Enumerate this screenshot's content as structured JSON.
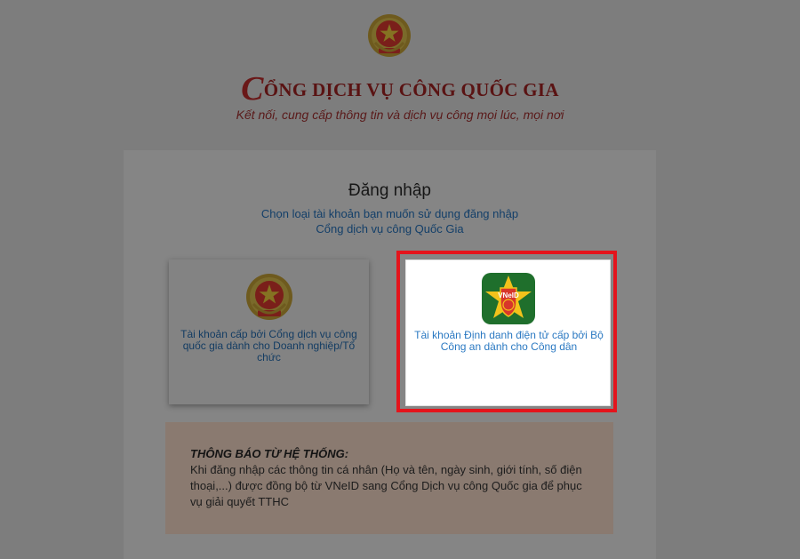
{
  "header": {
    "title_first_letter": "C",
    "title_rest": "ỔNG DỊCH VỤ CÔNG QUỐC GIA",
    "subtitle": "Kết nối, cung cấp thông tin và dịch vụ công mọi lúc, mọi nơi"
  },
  "login": {
    "title": "Đăng nhập",
    "hint_line1": "Chọn loại tài khoản bạn muốn sử dụng đăng nhập",
    "hint_line2": "Cổng dịch vụ công Quốc Gia"
  },
  "cards": {
    "organization": {
      "label": "Tài khoản cấp bởi Cổng dịch vụ công quốc gia dành cho Doanh nghiệp/Tổ chức",
      "icon": "national-emblem-icon"
    },
    "citizen": {
      "label": "Tài khoản Định danh điện tử cấp bởi Bộ Công an dành cho Công dân",
      "icon": "vneid-logo-icon",
      "logo_text": "VNeID"
    }
  },
  "notice": {
    "title": "THÔNG BÁO TỪ HỆ THỐNG:",
    "body": "Khi đăng nhập các thông tin cá nhân (Họ và tên, ngày sinh, giới tính, số điện thoại,...) được đồng bộ từ VNeID sang Cổng Dịch vụ công Quốc gia để phục vụ giải quyết TTHC"
  },
  "colors": {
    "overlay": "#7d7d7d",
    "highlight_border": "#e4141c",
    "link_blue": "#2b79c2",
    "title_red": "#5a1313"
  }
}
